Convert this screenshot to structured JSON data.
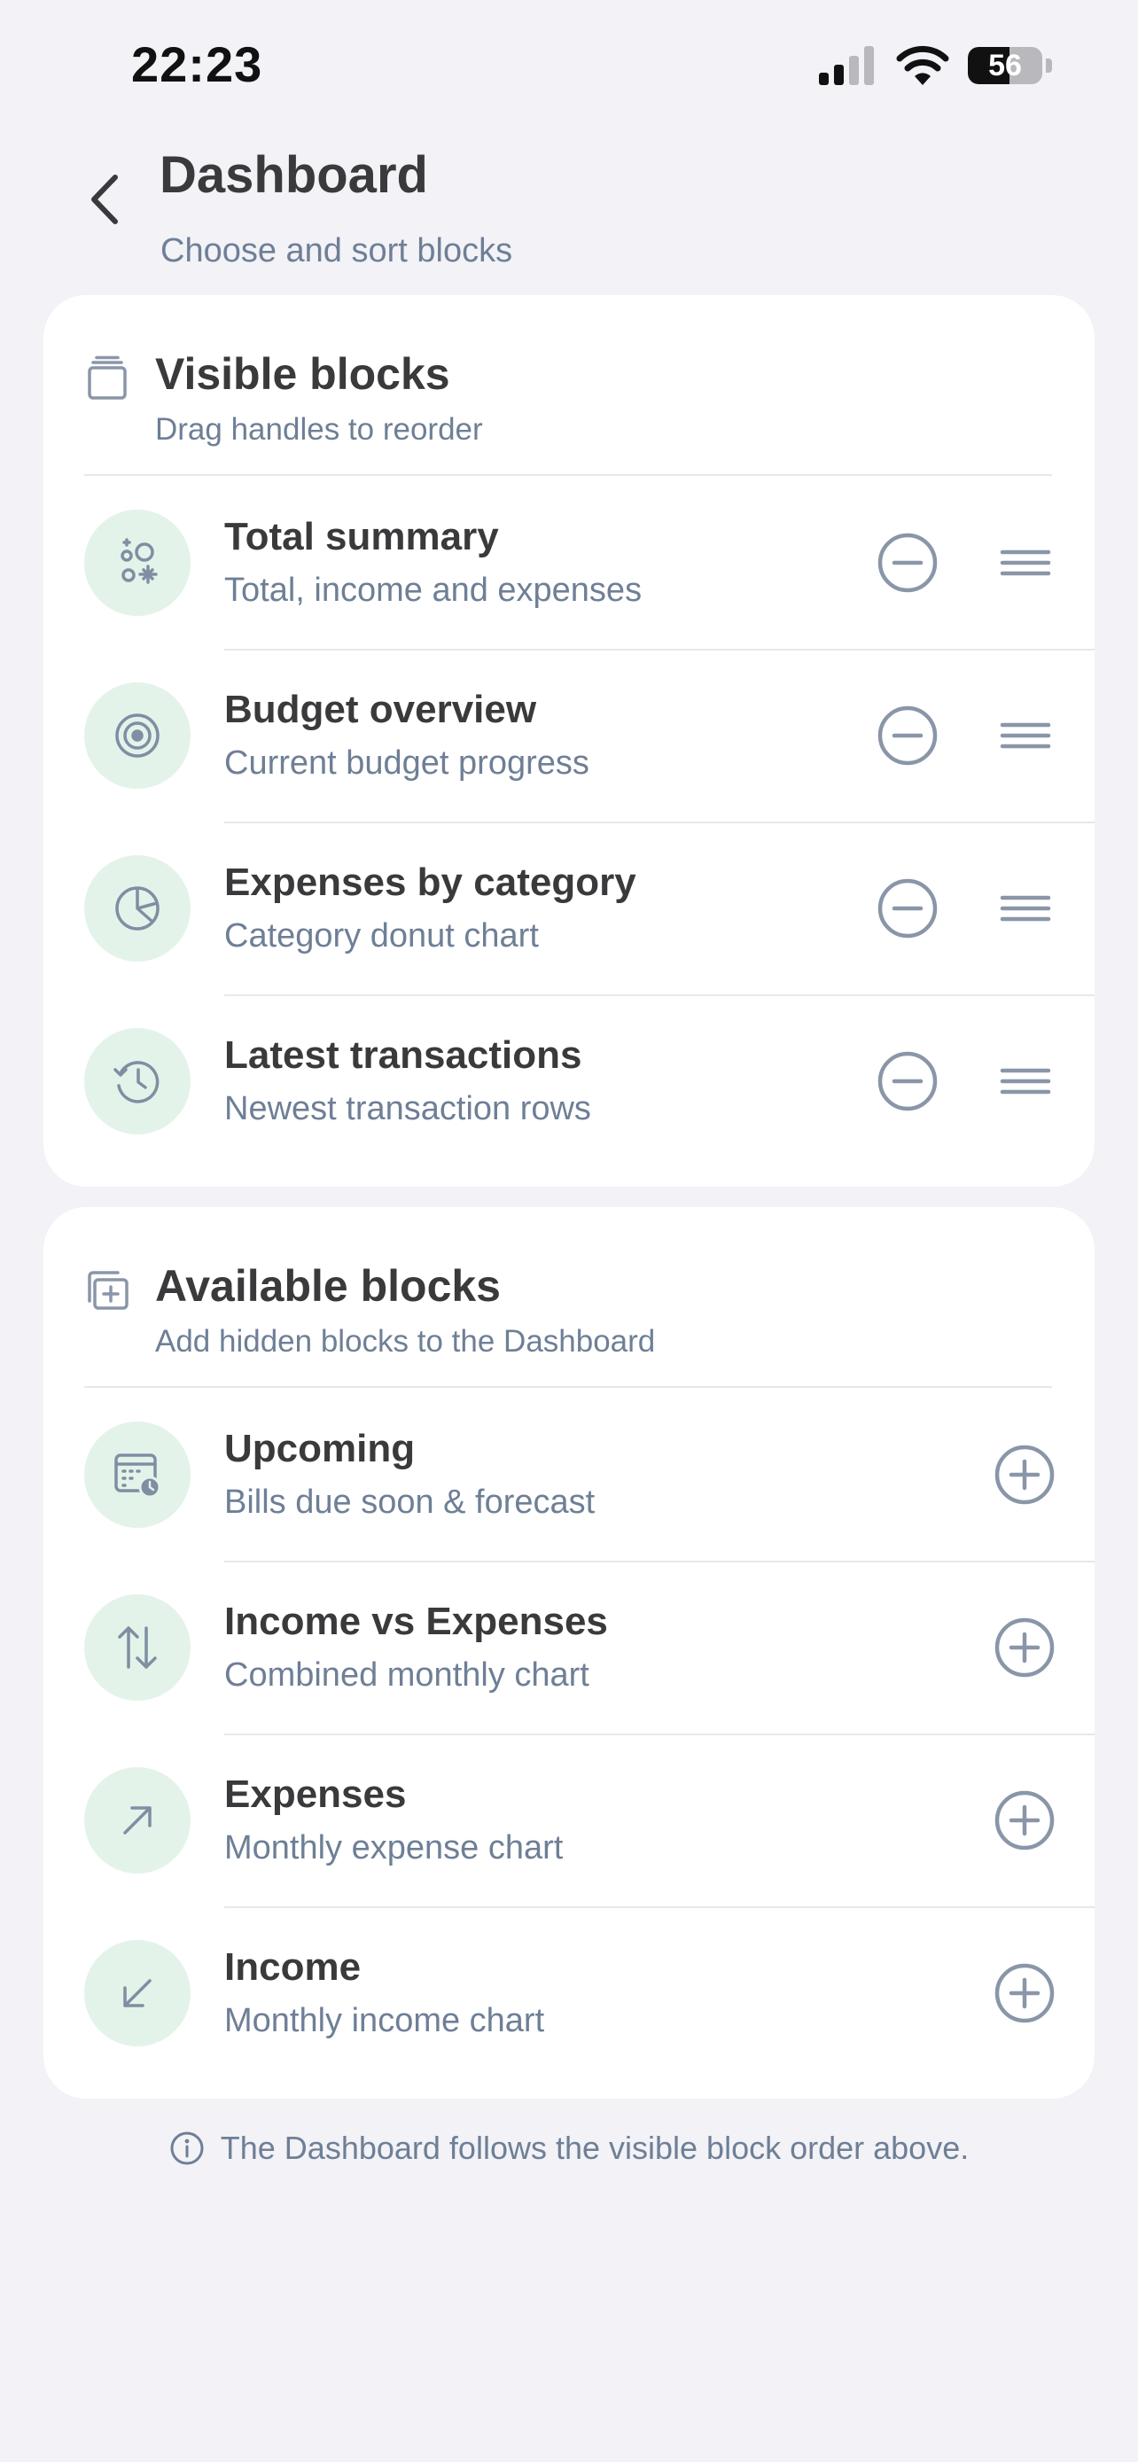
{
  "status_bar": {
    "time": "22:23",
    "battery_level": "56",
    "battery_fraction": 0.56
  },
  "header": {
    "title": "Dashboard",
    "subtitle": "Choose and sort blocks",
    "back_icon": "chevron-left-icon"
  },
  "visible_section": {
    "title": "Visible blocks",
    "subtitle": "Drag handles to reorder",
    "icon": "stack-icon",
    "items": [
      {
        "title": "Total summary",
        "description": "Total, income and expenses",
        "icon": "sparkles-icon"
      },
      {
        "title": "Budget overview",
        "description": "Current budget progress",
        "icon": "target-icon"
      },
      {
        "title": "Expenses by category",
        "description": "Category donut chart",
        "icon": "pie-chart-icon"
      },
      {
        "title": "Latest transactions",
        "description": "Newest transaction rows",
        "icon": "history-icon"
      }
    ]
  },
  "available_section": {
    "title": "Available blocks",
    "subtitle": "Add hidden blocks to the Dashboard",
    "icon": "add-stack-icon",
    "items": [
      {
        "title": "Upcoming",
        "description": "Bills due soon & forecast",
        "icon": "calendar-clock-icon"
      },
      {
        "title": "Income vs Expenses",
        "description": "Combined monthly chart",
        "icon": "arrows-up-down-icon"
      },
      {
        "title": "Expenses",
        "description": "Monthly expense chart",
        "icon": "arrow-up-right-icon"
      },
      {
        "title": "Income",
        "description": "Monthly income chart",
        "icon": "arrow-down-left-icon"
      }
    ]
  },
  "footer": {
    "note": "The Dashboard follows the visible block order above.",
    "icon": "info-icon"
  },
  "colors": {
    "background": "#f2f2f7",
    "card": "#ffffff",
    "icon_circle": "#e3f3e9",
    "icon_stroke": "#7f8ea3",
    "text_primary": "#3a3a3c",
    "text_secondary": "#6e7f96",
    "divider": "#e6e8ec"
  }
}
